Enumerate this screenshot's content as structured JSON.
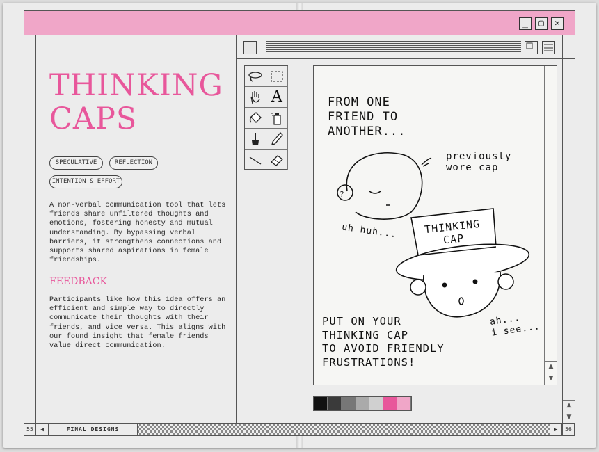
{
  "window": {
    "min_icon": "minimize-icon",
    "max_icon": "restore-icon",
    "close_icon": "close-icon"
  },
  "page": {
    "title_line1": "THINKING",
    "title_line2": "CAPS",
    "tags": [
      "SPECULATIVE",
      "REFLECTION",
      "INTENTION & EFFORT"
    ],
    "description": "A non-verbal communication tool that lets friends share unfiltered thoughts and emotions, fostering honesty and mutual understanding. By bypassing verbal barriers, it strengthens connections and supports shared aspirations in female friendships.",
    "feedback_heading": "FEEDBACK",
    "feedback_text": "Participants like how this idea offers an efficient and simple way to directly communicate their thoughts with their friends, and vice versa. This aligns with our found insight that female friends value direct communication."
  },
  "tools": [
    "lasso-icon",
    "marquee-select-icon",
    "hand-icon",
    "text-tool-icon",
    "paint-bucket-icon",
    "spray-can-icon",
    "brush-icon",
    "pencil-icon",
    "line-tool-icon",
    "eraser-icon"
  ],
  "text_tool_glyph": "A",
  "drawing": {
    "caption_top": [
      "FROM ONE",
      "FRIEND TO",
      "ANOTHER..."
    ],
    "note_previously": [
      "previously",
      "wore cap"
    ],
    "uh_huh": "uh huh...",
    "cap_label": [
      "THINKING",
      "CAP"
    ],
    "caption_bottom": [
      "PUT ON YOUR",
      "THINKING CAP",
      "TO AVOID FRIENDLY",
      "FRUSTRATIONS!"
    ],
    "ah_i_see": [
      "ah...",
      "i see..."
    ],
    "question_mark": "?"
  },
  "palette": [
    "#111111",
    "#3a3a3a",
    "#777777",
    "#aaaaaa",
    "#d0d0d0",
    "#e8579b",
    "#f0a6c8"
  ],
  "footer": {
    "page_left": "55",
    "section": "FINAL DESIGNS",
    "page_right": "56"
  }
}
